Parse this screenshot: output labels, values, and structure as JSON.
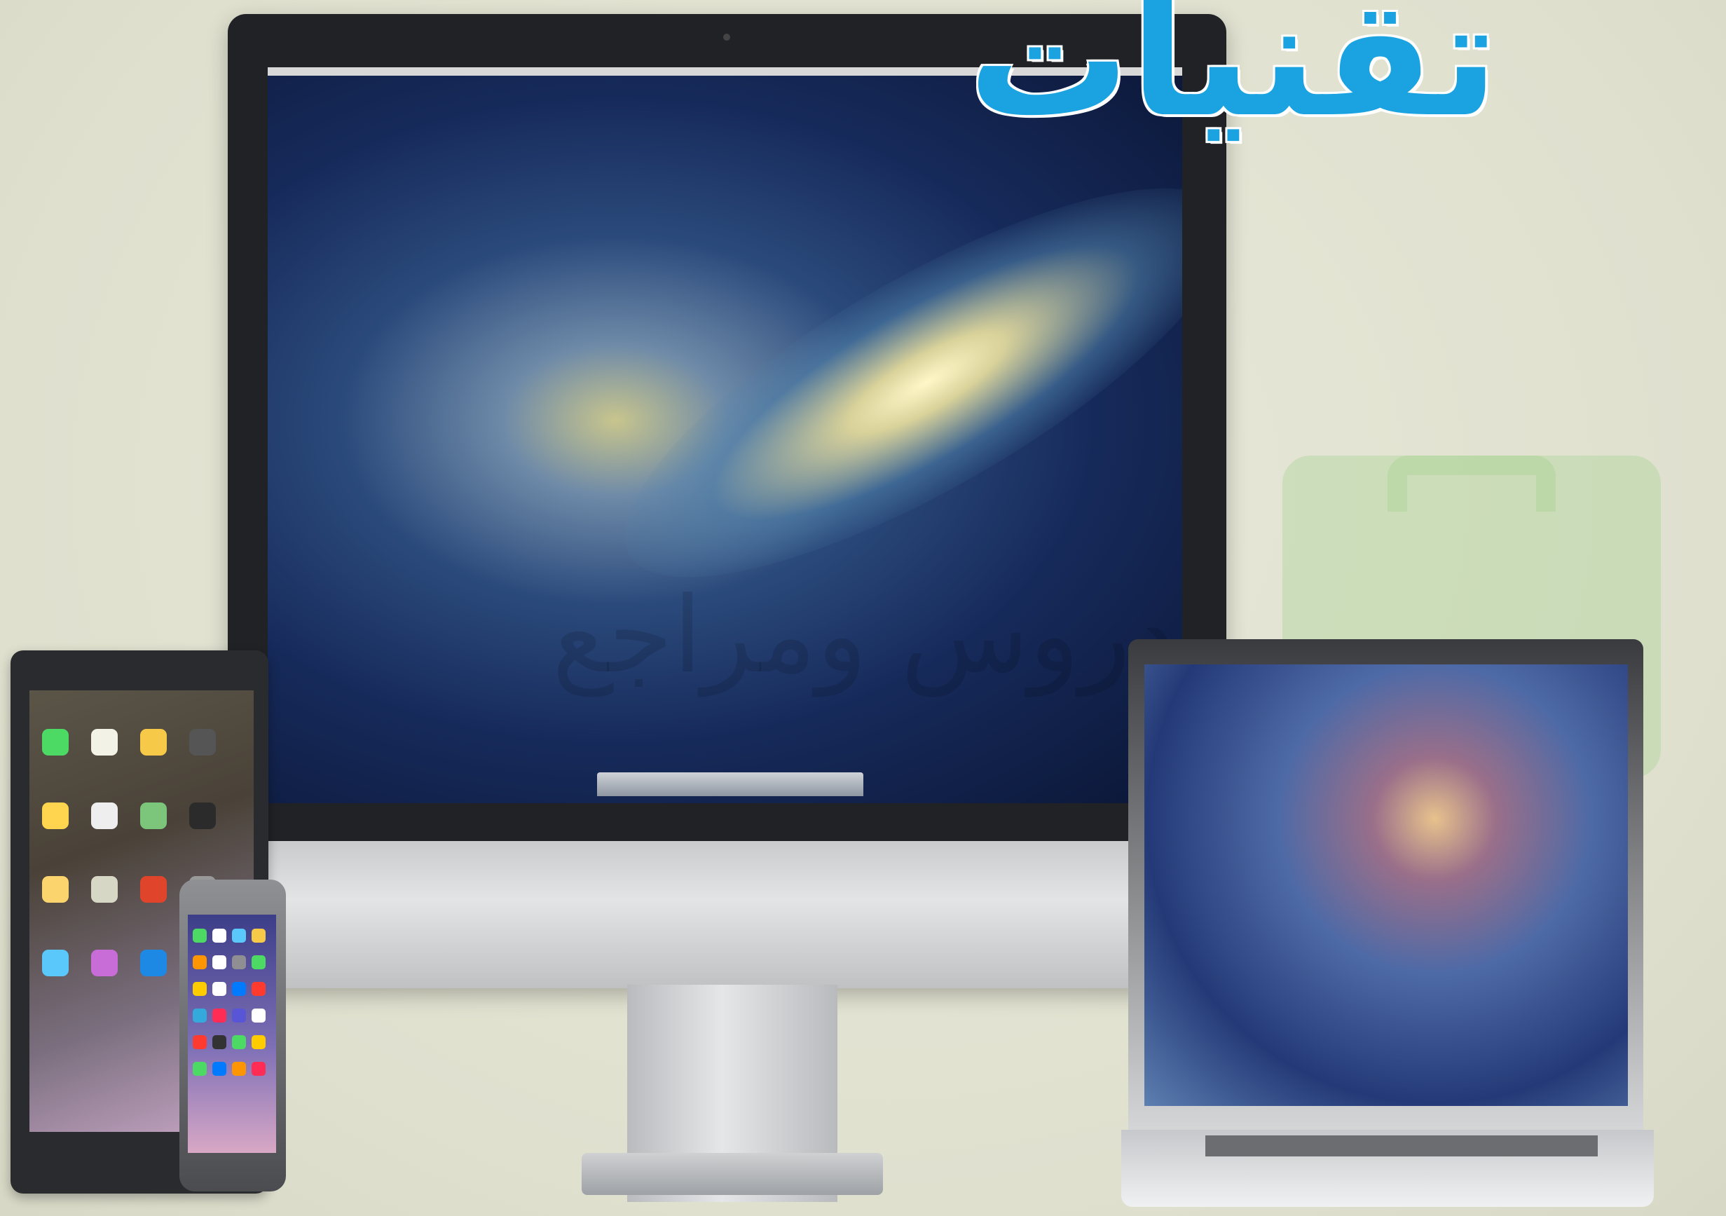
{
  "headline": "تقنيات",
  "watermark": "دروس ومراجع",
  "colors": {
    "background": "#e3e3d2",
    "headline_blue": "#1aa3e0"
  },
  "devices": [
    "iMac",
    "MacBook Pro",
    "iPad",
    "iPhone"
  ]
}
